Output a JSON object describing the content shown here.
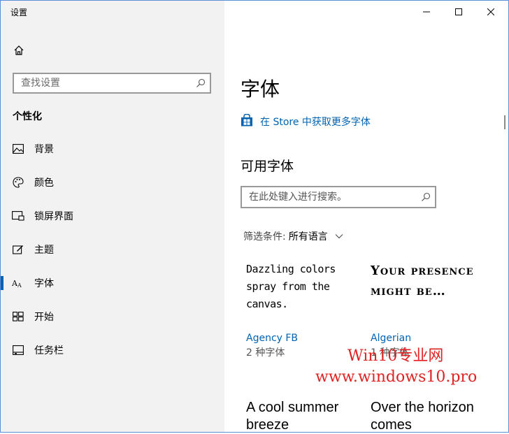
{
  "window": {
    "title": "设置",
    "colors": {
      "accent": "#0063b1",
      "sidebar_bg": "#f2f2f2",
      "watermark": "#e02222"
    }
  },
  "sidebar": {
    "search_placeholder": "查找设置",
    "section_title": "个性化",
    "items": [
      {
        "label": "背景",
        "icon": "picture-icon"
      },
      {
        "label": "颜色",
        "icon": "palette-icon"
      },
      {
        "label": "锁屏界面",
        "icon": "lock-screen-icon"
      },
      {
        "label": "主题",
        "icon": "theme-icon"
      },
      {
        "label": "字体",
        "icon": "font-icon",
        "active": true
      },
      {
        "label": "开始",
        "icon": "start-icon"
      },
      {
        "label": "任务栏",
        "icon": "taskbar-icon"
      }
    ]
  },
  "main": {
    "title": "字体",
    "store_link": "在 Store 中获取更多字体",
    "available_title": "可用字体",
    "search_placeholder": "在此处键入进行搜索。",
    "filter_label": "筛选条件:",
    "filter_value": "所有语言",
    "fonts": [
      {
        "sample": "Dazzling colors spray from the canvas.",
        "name": "Agency FB",
        "count": "2 种字体"
      },
      {
        "sample": "Your presence might be…",
        "name": "Algerian",
        "count": "1 种字体"
      },
      {
        "sample": "A cool summer breeze",
        "name": "",
        "count": ""
      },
      {
        "sample": "Over the horizon comes",
        "name": "",
        "count": ""
      }
    ]
  },
  "watermark": {
    "line1": "Win10专业网",
    "line2": "www.windows10.pro"
  }
}
